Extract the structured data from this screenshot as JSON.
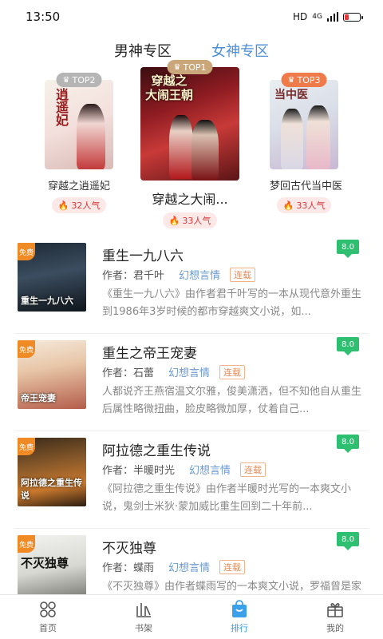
{
  "status_bar": {
    "time": "13:50",
    "network": "HD",
    "signal": "4G"
  },
  "zones": {
    "male": "男神专区",
    "female": "女神专区"
  },
  "podium": [
    {
      "rank": "TOP1",
      "name": "穿越之大闹...",
      "heat": "33人气",
      "cover_text": "穿越之\n大闹王朝",
      "badge_color": "#c9a77b"
    },
    {
      "rank": "TOP2",
      "name": "穿越之逍遥妃",
      "heat": "32人气",
      "cover_text": "逍遥妃",
      "badge_color": "#b0b0b0"
    },
    {
      "rank": "TOP3",
      "name": "梦回古代当中医",
      "heat": "33人气",
      "cover_text": "当中医",
      "badge_color": "#f07b4a"
    }
  ],
  "books": [
    {
      "title": "重生一九八六",
      "author_label": "作者：",
      "author": "君千叶",
      "genre": "幻想言情",
      "state": "连载",
      "score": "8.0",
      "desc": "《重生一九八六》由作者君千叶写的一本从现代意外重生到1986年3岁时候的都市穿越爽文小说，如...",
      "free_tag": "免费",
      "cover_text": "重生一九八六"
    },
    {
      "title": "重生之帝王宠妻",
      "author_label": "作者：",
      "author": "石蕾",
      "genre": "幻想言情",
      "state": "连载",
      "score": "8.0",
      "desc": "人都说齐王燕宿温文尔雅，俊美潇洒，但不知他自从重生后属性略微扭曲，脸皮略微加厚，仗着自己...",
      "free_tag": "免费",
      "cover_text": "帝王宠妻"
    },
    {
      "title": "阿拉德之重生传说",
      "author_label": "作者：",
      "author": "半暖时光",
      "genre": "幻想言情",
      "state": "连载",
      "score": "8.0",
      "desc": "《阿拉德之重生传说》由作者半暖时光写的一本爽文小说，鬼剑士米狄·蒙加威比重生回到二十年前...",
      "free_tag": "免费",
      "cover_text": "阿拉德之重生传说"
    },
    {
      "title": "不灭独尊",
      "author_label": "作者：",
      "author": "蝶雨",
      "genre": "幻想言情",
      "state": "连载",
      "score": "8.0",
      "desc": "《不灭独尊》由作者蝶雨写的一本爽文小说，罗福曾是家族中百年难遇的天才魔法师，可是当世人发...",
      "free_tag": "免费",
      "cover_text": "不灭独尊"
    }
  ],
  "nav": [
    {
      "label": "首页",
      "icon": "grid-icon"
    },
    {
      "label": "书架",
      "icon": "bookshelf-icon"
    },
    {
      "label": "排行",
      "icon": "ranking-bag-icon",
      "active": true
    },
    {
      "label": "我的",
      "icon": "gift-icon"
    }
  ]
}
